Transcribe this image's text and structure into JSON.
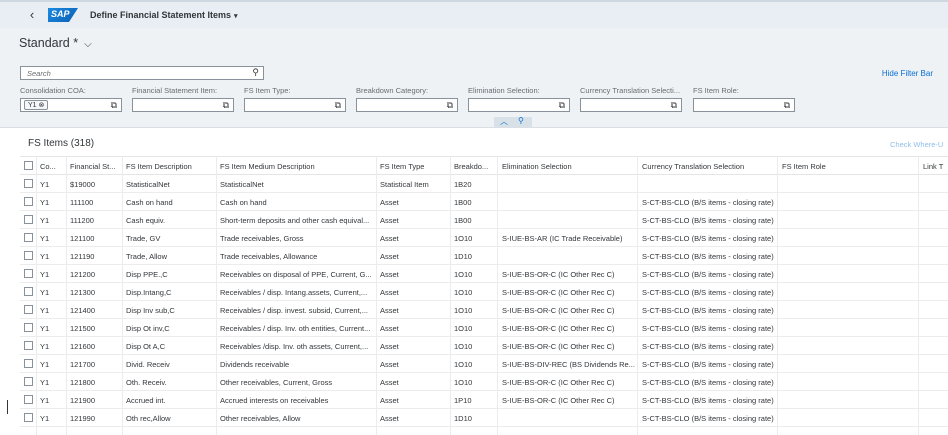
{
  "shell": {
    "back_icon": "‹",
    "logo_text": "SAP",
    "app_title": "Define Financial Statement Items",
    "title_caret": "▾"
  },
  "header": {
    "variant": "Standard *",
    "variant_chevron": "⌵",
    "search_placeholder": "Search",
    "search_icon": "⚲",
    "hide_filter_bar": "Hide Filter Bar"
  },
  "filters": [
    {
      "label": "Consolidation COA:",
      "token": "Y1 ⊗"
    },
    {
      "label": "Financial Statement Item:",
      "token": ""
    },
    {
      "label": "FS Item Type:",
      "token": ""
    },
    {
      "label": "Breakdown Category:",
      "token": ""
    },
    {
      "label": "Elimination Selection:",
      "token": ""
    },
    {
      "label": "Currency Translation Selecti...",
      "token": ""
    },
    {
      "label": "FS Item Role:",
      "token": ""
    }
  ],
  "value_help_icon": "⧉",
  "collapse_icons": {
    "up": "︿",
    "pin": "⚲"
  },
  "table": {
    "title": "FS Items (318)",
    "check_where": "Check Where-U",
    "columns": [
      "Co...",
      "Financial St...",
      "FS Item Description",
      "FS Item Medium Description",
      "FS Item Type",
      "Breakdo...",
      "Elimination Selection",
      "Currency Translation Selection",
      "FS Item Role",
      "Link T"
    ],
    "rows": [
      [
        "Y1",
        "$19000",
        "StatisticalNet",
        "StatisticalNet",
        "Statistical Item",
        "1B20",
        "",
        "",
        "",
        ""
      ],
      [
        "Y1",
        "111100",
        "Cash on hand",
        "Cash on hand",
        "Asset",
        "1B00",
        "",
        "S-CT-BS-CLO (B/S items - closing rate)",
        "",
        ""
      ],
      [
        "Y1",
        "111200",
        "Cash equiv.",
        "Short-term deposits and other cash equival...",
        "Asset",
        "1B00",
        "",
        "S-CT-BS-CLO (B/S items - closing rate)",
        "",
        ""
      ],
      [
        "Y1",
        "121100",
        "Trade, GV",
        "Trade receivables, Gross",
        "Asset",
        "1O10",
        "S-IUE-BS-AR (IC Trade Receivable)",
        "S-CT-BS-CLO (B/S items - closing rate)",
        "",
        ""
      ],
      [
        "Y1",
        "121190",
        "Trade, Allow",
        "Trade receivables, Allowance",
        "Asset",
        "1D10",
        "",
        "S-CT-BS-CLO (B/S items - closing rate)",
        "",
        ""
      ],
      [
        "Y1",
        "121200",
        "Disp PPE.,C",
        "Receivables on disposal of PPE, Current, G...",
        "Asset",
        "1O10",
        "S-IUE-BS-OR-C (IC Other Rec C)",
        "S-CT-BS-CLO (B/S items - closing rate)",
        "",
        ""
      ],
      [
        "Y1",
        "121300",
        "Disp.Intang,C",
        "Receivables / disp. Intang.assets, Current,...",
        "Asset",
        "1O10",
        "S-IUE-BS-OR-C (IC Other Rec C)",
        "S-CT-BS-CLO (B/S items - closing rate)",
        "",
        ""
      ],
      [
        "Y1",
        "121400",
        "Disp Inv sub,C",
        "Receivables / disp. invest. subsid, Current,...",
        "Asset",
        "1O10",
        "S-IUE-BS-OR-C (IC Other Rec C)",
        "S-CT-BS-CLO (B/S items - closing rate)",
        "",
        ""
      ],
      [
        "Y1",
        "121500",
        "Disp Ot inv,C",
        "Receivables / disp. Inv. oth entities, Current...",
        "Asset",
        "1O10",
        "S-IUE-BS-OR-C (IC Other Rec C)",
        "S-CT-BS-CLO (B/S items - closing rate)",
        "",
        ""
      ],
      [
        "Y1",
        "121600",
        "Disp Ot A,C",
        "Receivables /disp. Inv. oth assets, Current,...",
        "Asset",
        "1O10",
        "S-IUE-BS-OR-C (IC Other Rec C)",
        "S-CT-BS-CLO (B/S items - closing rate)",
        "",
        ""
      ],
      [
        "Y1",
        "121700",
        "Divid. Receiv",
        "Dividends receivable",
        "Asset",
        "1O10",
        "S-IUE-BS-DIV-REC (BS Dividends Re...",
        "S-CT-BS-CLO (B/S items - closing rate)",
        "",
        ""
      ],
      [
        "Y1",
        "121800",
        "Oth. Receiv.",
        "Other receivables, Current, Gross",
        "Asset",
        "1O10",
        "S-IUE-BS-OR-C (IC Other Rec C)",
        "S-CT-BS-CLO (B/S items - closing rate)",
        "",
        ""
      ],
      [
        "Y1",
        "121900",
        "Accrued int.",
        "Accrued interests on receivables",
        "Asset",
        "1P10",
        "S-IUE-BS-OR-C (IC Other Rec C)",
        "S-CT-BS-CLO (B/S items - closing rate)",
        "",
        ""
      ],
      [
        "Y1",
        "121990",
        "Oth rec,Allow",
        "Other receivables, Allow",
        "Asset",
        "1D10",
        "",
        "S-CT-BS-CLO (B/S items - closing rate)",
        "",
        ""
      ]
    ]
  }
}
